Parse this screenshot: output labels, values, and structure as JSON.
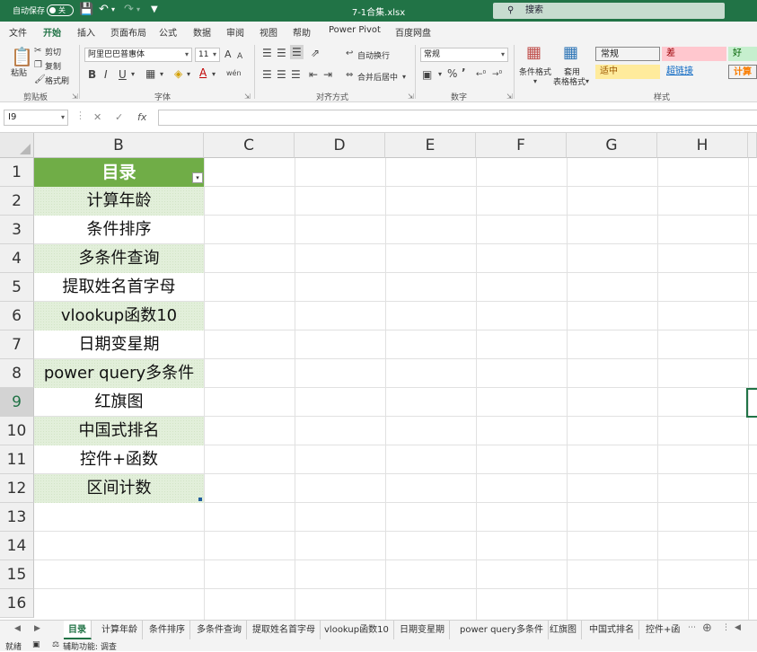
{
  "title_bar": {
    "autosave_label": "自动保存",
    "autosave_state": "关",
    "filename": "7-1合集.xlsx",
    "search_placeholder": "搜索"
  },
  "ribbon_tabs": [
    "文件",
    "开始",
    "插入",
    "页面布局",
    "公式",
    "数据",
    "审阅",
    "视图",
    "帮助",
    "Power Pivot",
    "百度网盘"
  ],
  "ribbon": {
    "clipboard": {
      "paste": "粘贴",
      "cut": "剪切",
      "copy": "复制",
      "format_painter": "格式刷",
      "label": "剪贴板"
    },
    "font": {
      "family": "阿里巴巴普惠体",
      "size": "11",
      "label": "字体",
      "bold": "B",
      "italic": "I",
      "underline": "U",
      "grow": "A",
      "shrink": "A",
      "font_color": "A",
      "phonetic": "wén"
    },
    "alignment": {
      "wrap_text": "自动换行",
      "merge_center": "合并后居中",
      "label": "对齐方式"
    },
    "number": {
      "format": "常规",
      "percent": "%",
      "label": "数字"
    },
    "styles": {
      "conditional_format": "条件格式",
      "table_format_line1": "套用",
      "table_format_line2": "表格格式",
      "label": "样式",
      "cells": [
        {
          "label": "常规",
          "bg": "#ffffff",
          "fg": "#000000"
        },
        {
          "label": "差",
          "bg": "#ffc7ce",
          "fg": "#9c0006"
        },
        {
          "label": "好",
          "bg": "#c6efce",
          "fg": "#006100"
        },
        {
          "label": "适中",
          "bg": "#ffeb9c",
          "fg": "#9c5700"
        },
        {
          "label": "超链接",
          "bg": "#f3f3f3",
          "fg": "#0563c1"
        },
        {
          "label": "计算",
          "bg": "#f2f2f2",
          "fg": "#fa7d00"
        }
      ]
    }
  },
  "formula_bar": {
    "name_box": "I9",
    "cancel": "✕",
    "enter": "✓",
    "fx": "fx",
    "formula": ""
  },
  "grid": {
    "columns": [
      "B",
      "C",
      "D",
      "E",
      "F",
      "G",
      "H"
    ],
    "rows": [
      "1",
      "2",
      "3",
      "4",
      "5",
      "6",
      "7",
      "8",
      "9",
      "10",
      "11",
      "12",
      "13",
      "14",
      "15",
      "16"
    ],
    "selected_row": "9",
    "header_cell": "目录",
    "catalog": [
      "计算年龄",
      "条件排序",
      "多条件查询",
      "提取姓名首字母",
      "vlookup函数10",
      "日期变星期",
      "power query多条件",
      "红旗图",
      "中国式排名",
      "控件+函数",
      "区间计数"
    ]
  },
  "sheet_tabs": [
    "目录",
    "计算年龄",
    "条件排序",
    "多条件查询",
    "提取姓名首字母",
    "vlookup函数10",
    "日期变星期",
    "power query多条件",
    "红旗图",
    "中国式排名",
    "控件+函"
  ],
  "status_bar": {
    "ready": "就绪",
    "accessibility": "辅助功能: 调查"
  },
  "colors": {
    "brand": "#217346",
    "header_fill": "#70ad47",
    "band_fill": "#e2efda"
  }
}
